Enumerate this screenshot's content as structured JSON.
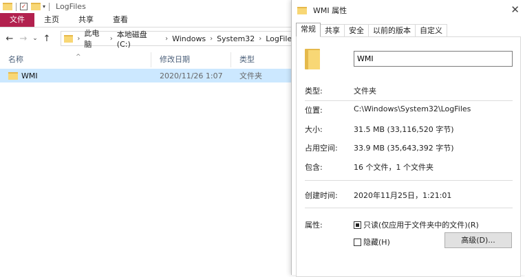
{
  "explorer": {
    "title": "LogFiles",
    "ribbon_tabs": [
      "文件",
      "主页",
      "共享",
      "查看"
    ],
    "breadcrumb": [
      "此电脑",
      "本地磁盘 (C:)",
      "Windows",
      "System32",
      "LogFiles"
    ],
    "columns": [
      "名称",
      "修改日期",
      "类型"
    ],
    "rows": [
      {
        "name": "WMI",
        "modified": "2020/11/26 1:07",
        "type": "文件夹"
      }
    ]
  },
  "dialog": {
    "title": "WMI 属性",
    "tabs": [
      "常规",
      "共享",
      "安全",
      "以前的版本",
      "自定义"
    ],
    "active_tab": "常规",
    "folder_name": "WMI",
    "type_label": "类型:",
    "type_value": "文件夹",
    "location_label": "位置:",
    "location_value": "C:\\Windows\\System32\\LogFiles",
    "size_label": "大小:",
    "size_value": "31.5 MB (33,116,520 字节)",
    "disk_size_label": "占用空间:",
    "disk_size_value": "33.9 MB (35,643,392 字节)",
    "contains_label": "包含:",
    "contains_value": "16 个文件，1 个文件夹",
    "created_label": "创建时间:",
    "created_value": "2020年11月25日，1:21:01",
    "attributes_label": "属性:",
    "readonly_label": "只读(仅应用于文件夹中的文件)(R)",
    "readonly_state": "indeterminate",
    "hidden_label": "隐藏(H)",
    "hidden_checked": false,
    "advanced_button": "高级(D)..."
  },
  "colors": {
    "file_tab": "#b2214e",
    "selection": "#cce8ff",
    "folder": "#f8d775"
  }
}
